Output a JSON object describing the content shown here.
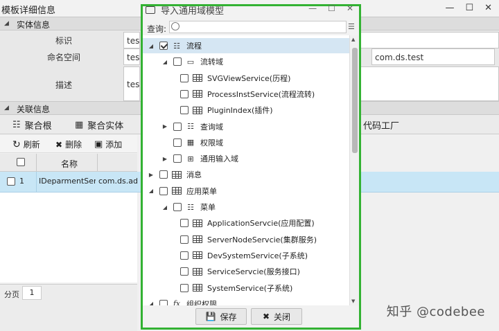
{
  "window": {
    "title": "模板详细信息",
    "controls": [
      "—",
      "☐",
      "✕"
    ]
  },
  "entity_section": {
    "title": "实体信息",
    "fields": {
      "id_label": "标识",
      "id_value": "test",
      "namespace_label": "命名空间",
      "namespace_value": "test",
      "namespace_value2": "com.ds.test",
      "desc_label": "描述",
      "desc_value": "test"
    }
  },
  "relation_section": {
    "title": "关联信息",
    "tabs": [
      {
        "label": "聚合根",
        "icon": "aggregate-root-icon"
      },
      {
        "label": "聚合实体",
        "icon": "aggregate-entity-icon"
      },
      {
        "label": "代码工厂",
        "icon": "code-factory-icon"
      }
    ]
  },
  "toolbar": {
    "refresh": "刷新",
    "delete": "删除",
    "add": "添加"
  },
  "grid": {
    "headers": {
      "name": "名称"
    },
    "rows": [
      {
        "index": "1",
        "name": "IDeparmentSer...",
        "ns": "com.ds.adm"
      }
    ]
  },
  "pager": {
    "label": "分页",
    "page": "1"
  },
  "dialog": {
    "title": "导入通用域模型",
    "controls": [
      "—",
      "☐",
      "✕"
    ],
    "search_label": "查询:",
    "search_value": "",
    "tree": [
      {
        "label": "流程",
        "level": 0,
        "expander": "◢",
        "checked": true,
        "icon": "tree-icon",
        "selected": true
      },
      {
        "label": "流转域",
        "level": 1,
        "expander": "◢",
        "checked": false,
        "icon": "folder-icon"
      },
      {
        "label": "SVGViewService(历程)",
        "level": 2,
        "expander": "",
        "checked": false,
        "icon": "table-icon"
      },
      {
        "label": "ProcessInstService(流程流转)",
        "level": 2,
        "expander": "",
        "checked": false,
        "icon": "table-icon"
      },
      {
        "label": "PluginIndex(插件)",
        "level": 2,
        "expander": "",
        "checked": false,
        "icon": "table-icon"
      },
      {
        "label": "查询域",
        "level": 1,
        "expander": "▶",
        "checked": false,
        "icon": "tree-icon"
      },
      {
        "label": "权限域",
        "level": 1,
        "expander": "",
        "checked": false,
        "icon": "grid-icon"
      },
      {
        "label": "通用输入域",
        "level": 1,
        "expander": "▶",
        "checked": false,
        "icon": "apps-icon"
      },
      {
        "label": "消息",
        "level": 0,
        "expander": "▶",
        "checked": false,
        "icon": "table-icon"
      },
      {
        "label": "应用菜单",
        "level": 0,
        "expander": "◢",
        "checked": false,
        "icon": "table-icon"
      },
      {
        "label": "菜单",
        "level": 1,
        "expander": "◢",
        "checked": false,
        "icon": "tree-icon"
      },
      {
        "label": "ApplicationServcie(应用配置)",
        "level": 2,
        "expander": "",
        "checked": false,
        "icon": "table-icon"
      },
      {
        "label": "ServerNodeServcie(集群服务)",
        "level": 2,
        "expander": "",
        "checked": false,
        "icon": "table-icon"
      },
      {
        "label": "DevSystemService(子系统)",
        "level": 2,
        "expander": "",
        "checked": false,
        "icon": "table-icon"
      },
      {
        "label": "ServiceServcie(服务接口)",
        "level": 2,
        "expander": "",
        "checked": false,
        "icon": "table-icon"
      },
      {
        "label": "SystemService(子系统)",
        "level": 2,
        "expander": "",
        "checked": false,
        "icon": "table-icon"
      },
      {
        "label": "组织权限",
        "level": 0,
        "expander": "◢",
        "checked": false,
        "icon": "fx-icon"
      }
    ],
    "save_label": "保存",
    "close_label": "关闭"
  },
  "watermark": "知乎 @codebee",
  "colors": {
    "dialog_border": "#33b233",
    "selected_row": "#c8e6f6",
    "selected_tree_node": "#d5e6f3"
  }
}
